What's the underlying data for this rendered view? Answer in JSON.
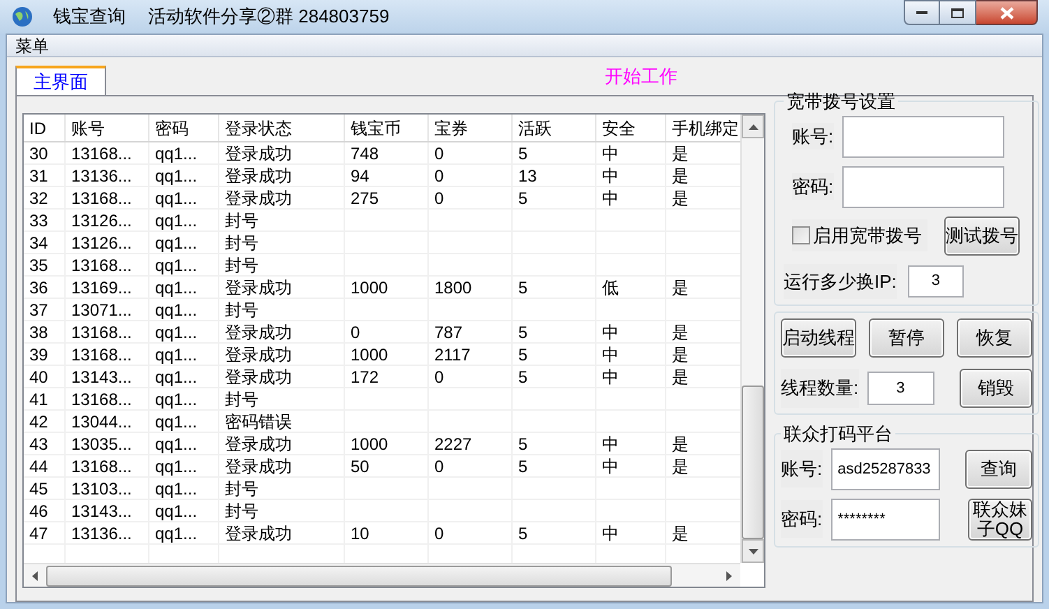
{
  "window": {
    "title": "钱宝查询",
    "subtitle": "活动软件分享②群 284803759"
  },
  "menu": [
    "菜单"
  ],
  "tabs": [
    {
      "label": "主界面",
      "selected": true
    }
  ],
  "status_label": "开始工作",
  "table": {
    "columns": [
      "ID",
      "账号",
      "密码",
      "登录状态",
      "钱宝币",
      "宝券",
      "活跃",
      "安全",
      "手机绑定"
    ],
    "rows": [
      [
        "30",
        "13168...",
        "qq1...",
        "登录成功",
        "748",
        "0",
        "5",
        "中",
        "是"
      ],
      [
        "31",
        "13136...",
        "qq1...",
        "登录成功",
        "94",
        "0",
        "13",
        "中",
        "是"
      ],
      [
        "32",
        "13168...",
        "qq1...",
        "登录成功",
        "275",
        "0",
        "5",
        "中",
        "是"
      ],
      [
        "33",
        "13126...",
        "qq1...",
        "封号",
        "",
        "",
        "",
        "",
        ""
      ],
      [
        "34",
        "13126...",
        "qq1...",
        "封号",
        "",
        "",
        "",
        "",
        ""
      ],
      [
        "35",
        "13168...",
        "qq1...",
        "封号",
        "",
        "",
        "",
        "",
        ""
      ],
      [
        "36",
        "13169...",
        "qq1...",
        "登录成功",
        "1000",
        "1800",
        "5",
        "低",
        "是"
      ],
      [
        "37",
        "13071...",
        "qq1...",
        "封号",
        "",
        "",
        "",
        "",
        ""
      ],
      [
        "38",
        "13168...",
        "qq1...",
        "登录成功",
        "0",
        "787",
        "5",
        "中",
        "是"
      ],
      [
        "39",
        "13168...",
        "qq1...",
        "登录成功",
        "1000",
        "2117",
        "5",
        "中",
        "是"
      ],
      [
        "40",
        "13143...",
        "qq1...",
        "登录成功",
        "172",
        "0",
        "5",
        "中",
        "是"
      ],
      [
        "41",
        "13168...",
        "qq1...",
        "封号",
        "",
        "",
        "",
        "",
        ""
      ],
      [
        "42",
        "13044...",
        "qq1...",
        "密码错误",
        "",
        "",
        "",
        "",
        ""
      ],
      [
        "43",
        "13035...",
        "qq1...",
        "登录成功",
        "1000",
        "2227",
        "5",
        "中",
        "是"
      ],
      [
        "44",
        "13168...",
        "qq1...",
        "登录成功",
        "50",
        "0",
        "5",
        "中",
        "是"
      ],
      [
        "45",
        "13103...",
        "qq1...",
        "封号",
        "",
        "",
        "",
        "",
        ""
      ],
      [
        "46",
        "13143...",
        "qq1...",
        "封号",
        "",
        "",
        "",
        "",
        ""
      ],
      [
        "47",
        "13136...",
        "qq1...",
        "登录成功",
        "10",
        "0",
        "5",
        "中",
        "是"
      ]
    ]
  },
  "broadband": {
    "title": "宽带拨号设置",
    "account_label": "账号:",
    "password_label": "密码:",
    "enable_label": "启用宽带拨号",
    "enable_checked": false,
    "test_button": "测试拨号",
    "ip_label": "运行多少换IP:",
    "ip_value": "3"
  },
  "threads": {
    "buttons": [
      "启动线程",
      "暂停",
      "恢复"
    ],
    "count_label": "线程数量:",
    "count_value": "3",
    "destroy_button": "销毁"
  },
  "captcha": {
    "title": "联众打码平台",
    "account_label": "账号:",
    "account_value": "asd25287833",
    "password_label": "密码:",
    "password_value": "********",
    "query_button": "查询",
    "qq_button": "联众妹子QQ"
  }
}
